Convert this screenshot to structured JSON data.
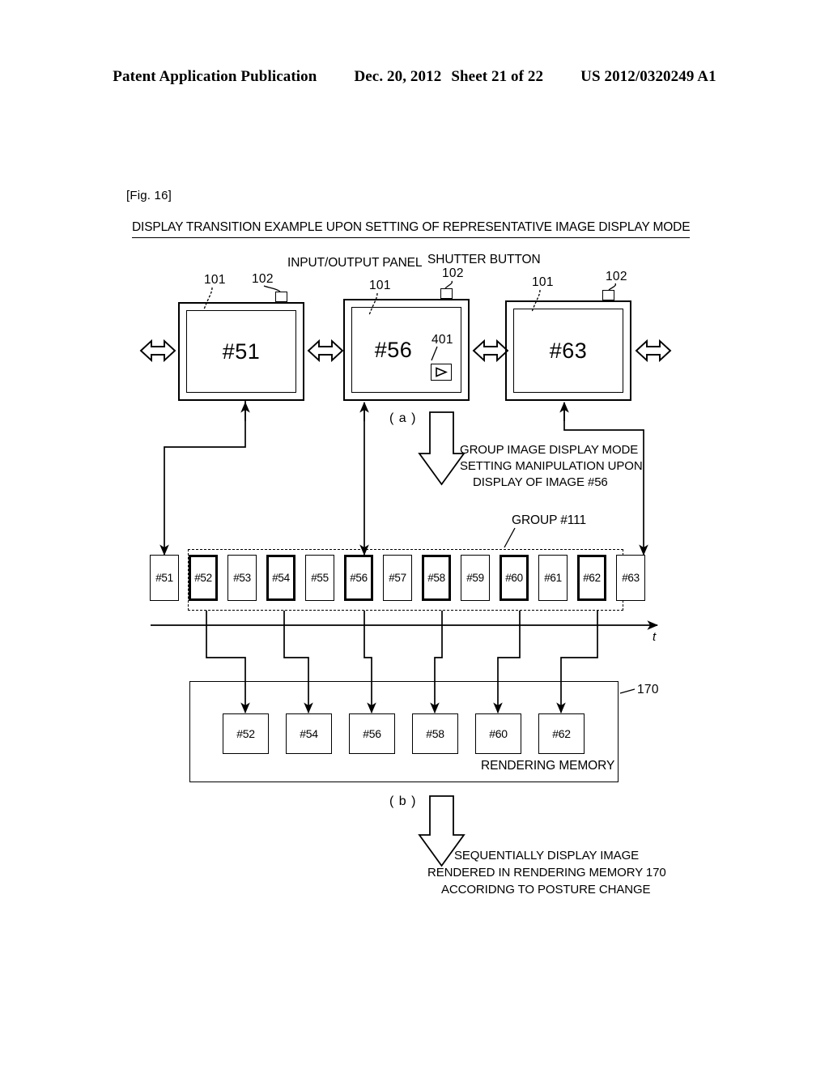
{
  "header": {
    "publication": "Patent Application Publication",
    "date": "Dec. 20, 2012",
    "sheet": "Sheet 21 of 22",
    "docnum": "US 2012/0320249 A1"
  },
  "figure": {
    "label": "[Fig. 16]",
    "title": "DISPLAY TRANSITION EXAMPLE UPON SETTING OF REPRESENTATIVE IMAGE DISPLAY MODE"
  },
  "annotations": {
    "input_output_panel": "INPUT/OUTPUT PANEL",
    "shutter_button": "SHUTTER BUTTON",
    "ref_101": "101",
    "ref_102": "102",
    "ref_401": "401",
    "ref_170": "170",
    "group_label": "GROUP #111",
    "t_axis": "t",
    "part_a": "( a )",
    "part_b": "( b )",
    "rendering_memory": "RENDERING MEMORY"
  },
  "devices": [
    {
      "screen": "#51",
      "ref_panel": "101",
      "ref_shutter": "102"
    },
    {
      "screen": "#56",
      "ref_panel": "101",
      "ref_shutter": "102",
      "badge": "play-icon",
      "ref_badge": "401"
    },
    {
      "screen": "#63",
      "ref_panel": "101",
      "ref_shutter": "102"
    }
  ],
  "transition_note": {
    "line1": "GROUP IMAGE DISPLAY MODE",
    "line2": "SETTING MANIPULATION UPON",
    "line3": "DISPLAY OF IMAGE #56"
  },
  "bottom_note": {
    "line1": "SEQUENTIALLY DISPLAY IMAGE",
    "line2": "RENDERED IN RENDERING MEMORY 170",
    "line3": "ACCORIDNG TO POSTURE CHANGE"
  },
  "timeline": {
    "items": [
      {
        "label": "#51",
        "highlighted": false,
        "in_group": false
      },
      {
        "label": "#52",
        "highlighted": true,
        "in_group": true
      },
      {
        "label": "#53",
        "highlighted": false,
        "in_group": true
      },
      {
        "label": "#54",
        "highlighted": true,
        "in_group": true
      },
      {
        "label": "#55",
        "highlighted": false,
        "in_group": true
      },
      {
        "label": "#56",
        "highlighted": true,
        "in_group": true
      },
      {
        "label": "#57",
        "highlighted": false,
        "in_group": true
      },
      {
        "label": "#58",
        "highlighted": true,
        "in_group": true
      },
      {
        "label": "#59",
        "highlighted": false,
        "in_group": true
      },
      {
        "label": "#60",
        "highlighted": true,
        "in_group": true
      },
      {
        "label": "#61",
        "highlighted": false,
        "in_group": true
      },
      {
        "label": "#62",
        "highlighted": true,
        "in_group": true
      },
      {
        "label": "#63",
        "highlighted": false,
        "in_group": false
      }
    ]
  },
  "memory": {
    "items": [
      "#52",
      "#54",
      "#56",
      "#58",
      "#60",
      "#62"
    ]
  },
  "colors": {
    "ink": "#000000",
    "paper": "#ffffff"
  }
}
